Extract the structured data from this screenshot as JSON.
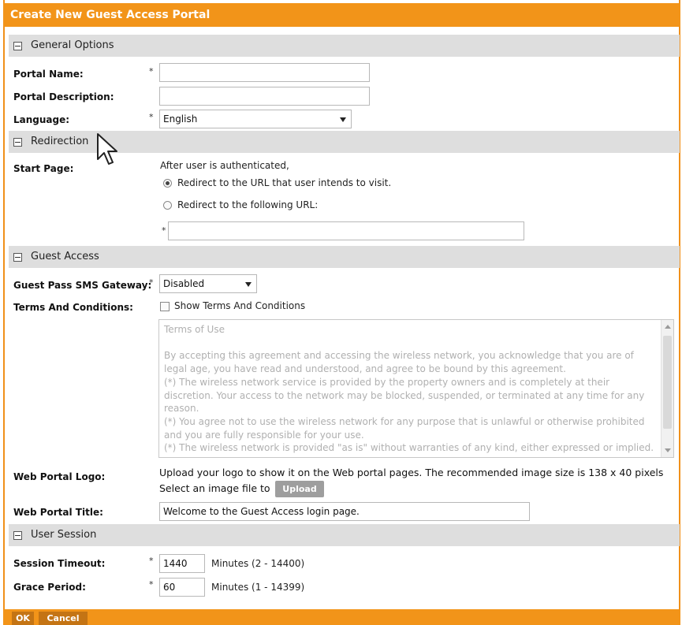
{
  "dialog": {
    "title": "Create New Guest Access Portal"
  },
  "sections": {
    "general": {
      "label": "General Options"
    },
    "redirection": {
      "label": "Redirection"
    },
    "guest_access": {
      "label": "Guest Access"
    },
    "user_session": {
      "label": "User Session"
    }
  },
  "general": {
    "portal_name": {
      "label": "Portal Name:",
      "value": "",
      "required": "*"
    },
    "portal_description": {
      "label": "Portal Description:",
      "value": ""
    },
    "language": {
      "label": "Language:",
      "value": "English",
      "required": "*"
    }
  },
  "redirection": {
    "start_page_label": "Start Page:",
    "intro": "After user is authenticated,",
    "option_intended": "Redirect to the URL that user intends to visit.",
    "option_following": "Redirect to the following URL:",
    "url_required": "*",
    "url_value": ""
  },
  "guest_access": {
    "sms_gateway": {
      "label": "Guest Pass SMS Gateway:",
      "value": "Disabled",
      "required": "*"
    },
    "terms_label": "Terms And Conditions:",
    "show_terms": "Show Terms And Conditions",
    "terms_text": "Terms of Use\n\nBy accepting this agreement and accessing the wireless network, you acknowledge that you are of legal age, you have read and understood, and agree to be bound by this agreement.\n(*) The wireless network service is provided by the property owners and is completely at their discretion. Your access to the network may be blocked, suspended, or terminated at any time for any reason.\n(*) You agree not to use the wireless network for any purpose that is unlawful or otherwise prohibited and you are fully responsible for your use.\n(*) The wireless network is provided \"as is\" without warranties of any kind, either expressed or implied.",
    "logo_label": "Web Portal Logo:",
    "logo_hint": "Upload your logo to show it on the Web portal pages. The recommended image size is 138 x 40 pixels",
    "select_file": "Select an image file to",
    "upload_button": "Upload",
    "title_label": "Web Portal Title:",
    "title_value": "Welcome to the Guest Access login page."
  },
  "user_session": {
    "session_timeout": {
      "label": "Session Timeout:",
      "value": "1440",
      "unit": "Minutes (2 - 14400)",
      "required": "*"
    },
    "grace_period": {
      "label": "Grace Period:",
      "value": "60",
      "unit": "Minutes (1 - 14399)",
      "required": "*"
    }
  },
  "footer": {
    "ok": "OK",
    "cancel": "Cancel"
  },
  "colors": {
    "accent": "#f29419",
    "section_bg": "#dedede"
  }
}
